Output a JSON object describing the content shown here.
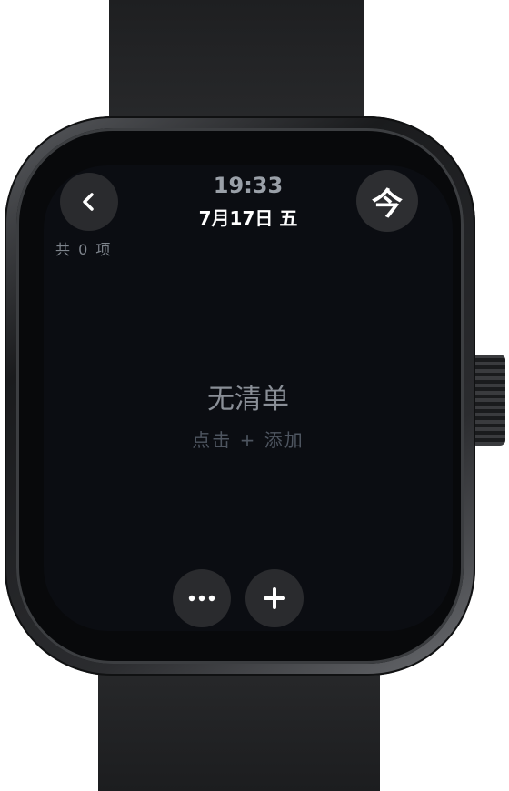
{
  "status": {
    "time": "19:33",
    "date": "7月17日 五"
  },
  "header": {
    "today_label": "今"
  },
  "list": {
    "count_text": "共 0 项"
  },
  "empty": {
    "title": "无清单",
    "hint": "点击 + 添加"
  },
  "icons": {
    "back": "chevron-left-icon",
    "more": "more-horizontal-icon",
    "add": "plus-icon"
  },
  "colors": {
    "screen_bg": "#0b0d12",
    "button_bg": "#2a2b2e",
    "text_primary": "#ffffff",
    "text_muted": "#8a8f97"
  }
}
